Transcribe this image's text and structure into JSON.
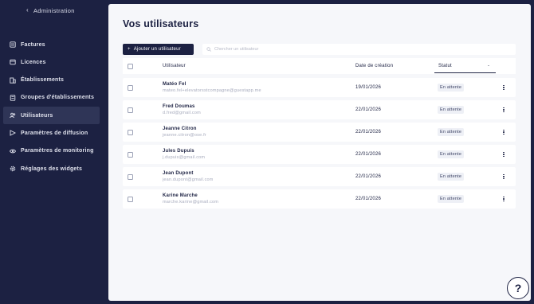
{
  "sidebar": {
    "back_label": "Administration",
    "items": [
      {
        "label": "Factures",
        "icon": "invoice-icon"
      },
      {
        "label": "Licences",
        "icon": "license-icon"
      },
      {
        "label": "Établissements",
        "icon": "building-icon"
      },
      {
        "label": "Groupes d'établissements",
        "icon": "group-icon"
      },
      {
        "label": "Utilisateurs",
        "icon": "users-icon",
        "active": true
      },
      {
        "label": "Paramètres de diffusion",
        "icon": "broadcast-icon"
      },
      {
        "label": "Paramètres de monitoring",
        "icon": "eye-icon"
      },
      {
        "label": "Réglages des widgets",
        "icon": "gear-icon"
      }
    ]
  },
  "main": {
    "title": "Vos utilisateurs",
    "add_button": "Ajouter un utilisateur",
    "search_placeholder": "Chercher un utilisateur",
    "columns": {
      "user": "Utilisateur",
      "date": "Date de création",
      "status": "Statut",
      "sort": "-"
    },
    "rows": [
      {
        "name": "Matéo Fel",
        "email": "mateo.fel+elevatorsstcompagne@guestapp.me",
        "date": "19/01/2026",
        "status": "En attente"
      },
      {
        "name": "Fred Doumas",
        "email": "d.fred@gmail.com",
        "date": "22/01/2026",
        "status": "En attente"
      },
      {
        "name": "Jeanne Citron",
        "email": "jeanne.citron@ose.fr",
        "date": "22/01/2026",
        "status": "En attente"
      },
      {
        "name": "Jules Dupuis",
        "email": "j.dupuis@gmail.com",
        "date": "22/01/2026",
        "status": "En attente"
      },
      {
        "name": "Jean Dupont",
        "email": "jean.dupont@gmail.com",
        "date": "22/01/2026",
        "status": "En attente"
      },
      {
        "name": "Karine Marche",
        "email": "marche.karine@gmail.com",
        "date": "22/01/2026",
        "status": "En attente"
      }
    ]
  },
  "help": {
    "label": "?"
  }
}
